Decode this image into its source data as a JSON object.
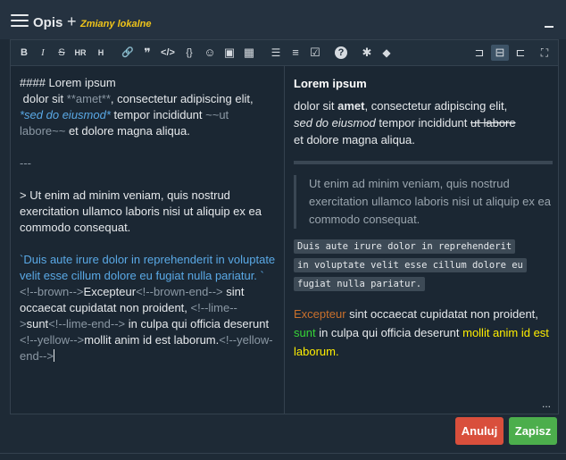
{
  "header": {
    "title": "Opis",
    "plus": "+",
    "subtitle": "Zmiany lokalne"
  },
  "toolbar": {
    "bold": "B",
    "italic": "I",
    "strike": "S",
    "hr": "HR",
    "heading": "H",
    "link": "🔗",
    "quote": "❞",
    "code": "</>",
    "codeblock": "{}",
    "emoji": "☺",
    "image": "▣",
    "table": "▦",
    "ul": "☰",
    "ol": "≡",
    "task": "☑",
    "help": "?",
    "plugin": "✱",
    "color": "◆",
    "view_editor": "⊐",
    "view_split": "⊟",
    "view_preview": "⊏",
    "fullscreen": "⛶"
  },
  "source": {
    "l1": "#### Lorem ipsum",
    "l2a": " dolor sit ",
    "l2b": "**amet**",
    "l2c": ", consectetur adipiscing elit,",
    "l3a": "*sed do eiusmod*",
    "l3b": " tempor incididunt ",
    "l3c": "~~ut",
    "l4a": "labore~~",
    "l4b": " et dolore magna aliqua.",
    "l5": "---",
    "l6": "> Ut enim ad minim veniam, quis nostrud exercitation ullamco laboris nisi ut aliquip ex ea commodo consequat.",
    "l7": "`Duis aute irure dolor in reprehenderit in voluptate velit esse cillum dolore eu fugiat nulla pariatur. `",
    "l8a": "<!--brown-->",
    "l8b": "Excepteur",
    "l8c": "<!--brown-end-->",
    "l8d": " sint occaecat cupidatat non proident, ",
    "l8e": "<!--lime-->",
    "l8f": "sunt",
    "l8g": "<!--lime-end-->",
    "l8h": " in culpa qui officia deserunt ",
    "l8i": "<!--yellow-->",
    "l8j": "mollit anim id est laborum.",
    "l8k": "<!--yellow-end-->"
  },
  "preview": {
    "heading": "Lorem ipsum",
    "p1a": "dolor sit ",
    "p1b": "amet",
    "p1c": ", consectetur adipiscing elit,",
    "p1d": "sed do eiusmod",
    "p1e": " tempor incididunt ",
    "p1f": "ut labore",
    "p1g": " et dolore magna aliqua.",
    "quote": "Ut enim ad minim veniam, quis nostrud exercitation ullamco laboris nisi ut aliquip ex ea commodo consequat.",
    "code1": "Duis aute irure dolor in reprehenderit",
    "code2": "in voluptate velit esse cillum dolore eu",
    "code3": "fugiat nulla pariatur.",
    "c1": "Excepteur",
    "c2": " sint occaecat cupidatat non proident, ",
    "c3": "sunt",
    "c4": " in culpa qui officia deserunt ",
    "c5": "mollit anim id est laborum.",
    "more": "..."
  },
  "buttons": {
    "cancel": "Anuluj",
    "save": "Zapisz"
  },
  "colors": {
    "accent_subtitle": "#f0c419",
    "cancel": "#d94f3c",
    "save": "#4cae4c",
    "brown": "#c9702c",
    "lime": "#36d436",
    "yellow": "#ffee00"
  }
}
